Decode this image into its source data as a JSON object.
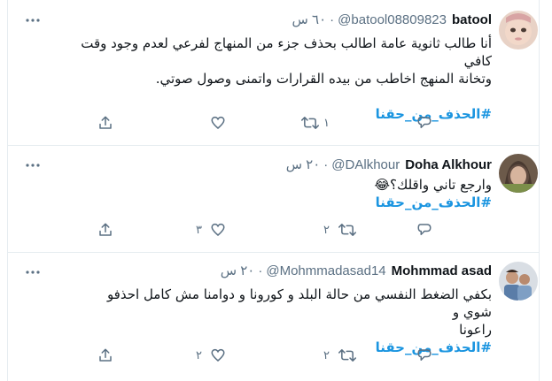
{
  "tweets": [
    {
      "name": "batool",
      "handle": "@batool08809823",
      "time": "٦٠ س",
      "text_lines": [
        "أنا طالب ثانوية عامة اطالب بحذف جزء من المنهاج لفرعي لعدم وجود وقت كافي",
        "وتخانة المنهج اخاطب من بيده القرارات واتمنى وصول صوتي."
      ],
      "hashtag": "#الحذف_من_حقنا",
      "reply_count": "",
      "retweet_count": "١",
      "like_count": "",
      "icons": [
        "share-icon",
        "like-icon",
        "retweet-icon",
        "reply-icon",
        "more-icon"
      ]
    },
    {
      "name": "Doha Alkhour",
      "handle": "@DAlkhour",
      "time": "٢٠ س",
      "text_lines": [
        "وارجع تاني واقلك؟😂"
      ],
      "hashtag": "#الحذف_من_حقنا",
      "reply_count": "",
      "retweet_count": "٢",
      "like_count": "٣",
      "icons": [
        "share-icon",
        "like-icon",
        "retweet-icon",
        "reply-icon",
        "more-icon"
      ]
    },
    {
      "name": "Mohmmad asad",
      "handle": "@Mohmmadasad14",
      "time": "٢٠ س",
      "text_lines": [
        "بكفي الضغط النفسي من حالة البلد و كورونا و دوامنا مش كامل احذفو شوي و",
        "راعونا"
      ],
      "hashtag": "#الحذف_من_حقنا",
      "reply_count": "",
      "retweet_count": "٢",
      "like_count": "٢",
      "icons": [
        "share-icon",
        "like-icon",
        "retweet-icon",
        "reply-icon",
        "more-icon"
      ]
    }
  ],
  "colors": {
    "hashtag": "#1b95e0",
    "secondary_text": "#5b7083",
    "divider": "#e6ecf0"
  }
}
